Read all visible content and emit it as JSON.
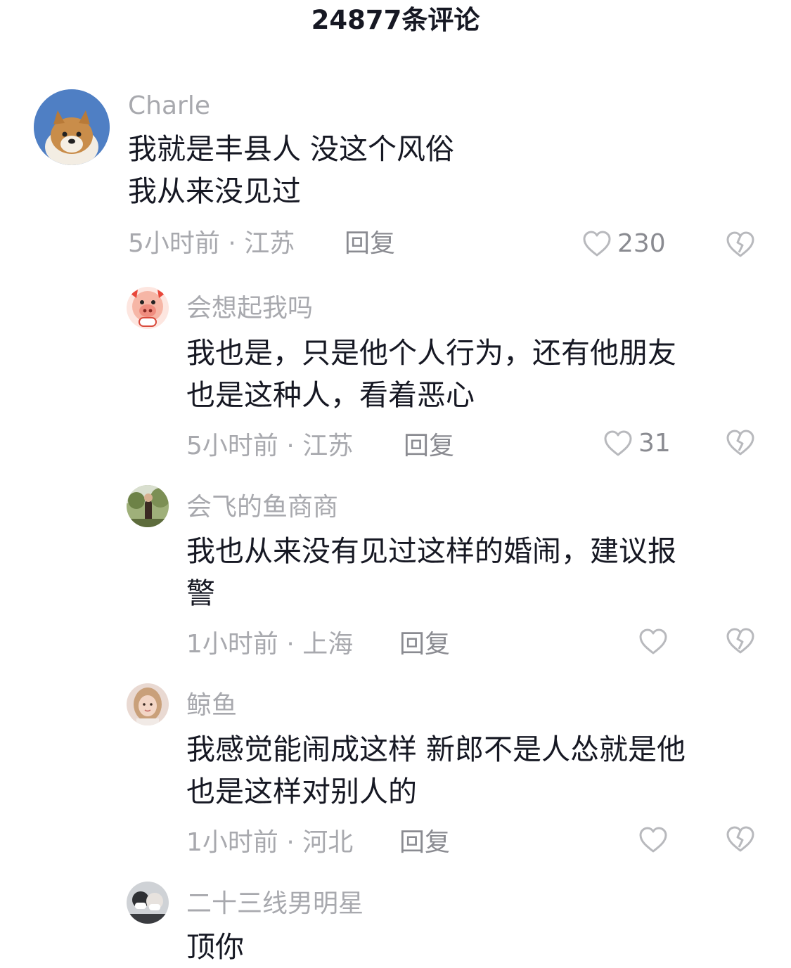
{
  "header": {
    "title": "24877条评论"
  },
  "comments": [
    {
      "username": "Charle",
      "text_lines": [
        "我就是丰县人  没这个风俗",
        "我从来没见过"
      ],
      "meta": "5小时前 · 江苏",
      "reply_label": "回复",
      "likes": "230",
      "avatar": "shiba-dog-avatar"
    },
    {
      "username": "会想起我吗",
      "text_lines": [
        "我也是，只是他个人行为，还有他朋友",
        "也是这种人，看着恶心"
      ],
      "meta": "5小时前 · 江苏",
      "reply_label": "回复",
      "likes": "31",
      "avatar": "cartoon-pig-avatar"
    },
    {
      "username": "会飞的鱼商商",
      "text_lines": [
        "我也从来没有见过这样的婚闹，建议报",
        "警"
      ],
      "meta": "1小时前 · 上海",
      "reply_label": "回复",
      "likes": "",
      "avatar": "outdoor-person-avatar"
    },
    {
      "username": "鲸鱼",
      "text_lines": [
        "我感觉能闹成这样 新郎不是人怂就是他",
        "也是这样对别人的"
      ],
      "meta": "1小时前 · 河北",
      "reply_label": "回复",
      "likes": "",
      "avatar": "girl-portrait-avatar"
    },
    {
      "username": "二十三线男明星",
      "text_lines": [
        "顶你"
      ],
      "meta": "",
      "reply_label": "",
      "likes": "",
      "avatar": "couple-mask-avatar"
    }
  ],
  "icons": {
    "like": "heart-outline-icon",
    "dislike": "broken-heart-icon"
  },
  "colors": {
    "text": "#161823",
    "secondary": "#a8a9ae",
    "icon": "#b8b9bd"
  }
}
